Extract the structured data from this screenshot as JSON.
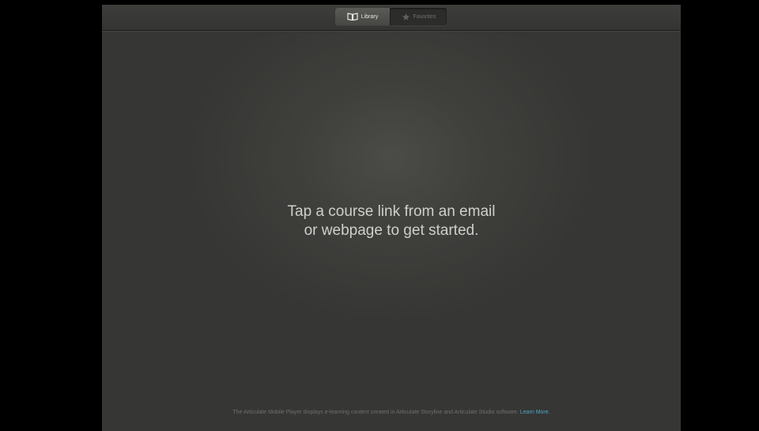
{
  "app": {
    "tabs": {
      "library_label": "Library",
      "favorites_label": "Favorites"
    },
    "message": {
      "line1": "Tap a course link from an email",
      "line2": "or webpage to get started."
    },
    "footer": {
      "text": "The Articulate Mobile Player displays e-learning content created in Articulate Storyline and Articulate Studio software.",
      "link_label": "Learn More."
    },
    "icons": {
      "library": "book-icon",
      "favorites": "star-icon"
    },
    "colors": {
      "background": "#3f3f3c",
      "link": "#4fa7c9",
      "text": "#cfcfcb"
    }
  }
}
